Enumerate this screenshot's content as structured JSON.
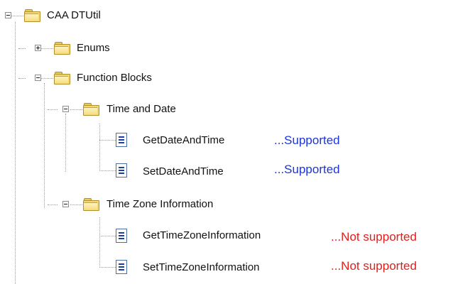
{
  "tree": {
    "root": {
      "label": "CAA DTUtil",
      "icon": "folder-icon",
      "expanded": true
    },
    "enums": {
      "label": "Enums",
      "icon": "folder-icon",
      "expanded": false
    },
    "function_blocks": {
      "label": "Function Blocks",
      "icon": "folder-icon",
      "expanded": true
    },
    "time_and_date": {
      "label": "Time and Date",
      "icon": "folder-icon",
      "expanded": true,
      "items": [
        {
          "label": "GetDateAndTime",
          "icon": "document-icon",
          "status": "...Supported"
        },
        {
          "label": "SetDateAndTime",
          "icon": "document-icon",
          "status": "...Supported"
        }
      ]
    },
    "time_zone_information": {
      "label": "Time Zone Information",
      "icon": "folder-icon",
      "expanded": true,
      "items": [
        {
          "label": "GetTimeZoneInformation",
          "icon": "document-icon",
          "status": "...Not supported"
        },
        {
          "label": "SetTimeZoneInformation",
          "icon": "document-icon",
          "status": "...Not supported"
        }
      ]
    }
  },
  "colors": {
    "supported": "#1b35d8",
    "not_supported": "#e0201c",
    "folder": "#f2d871",
    "connector": "#9a9a9a"
  }
}
